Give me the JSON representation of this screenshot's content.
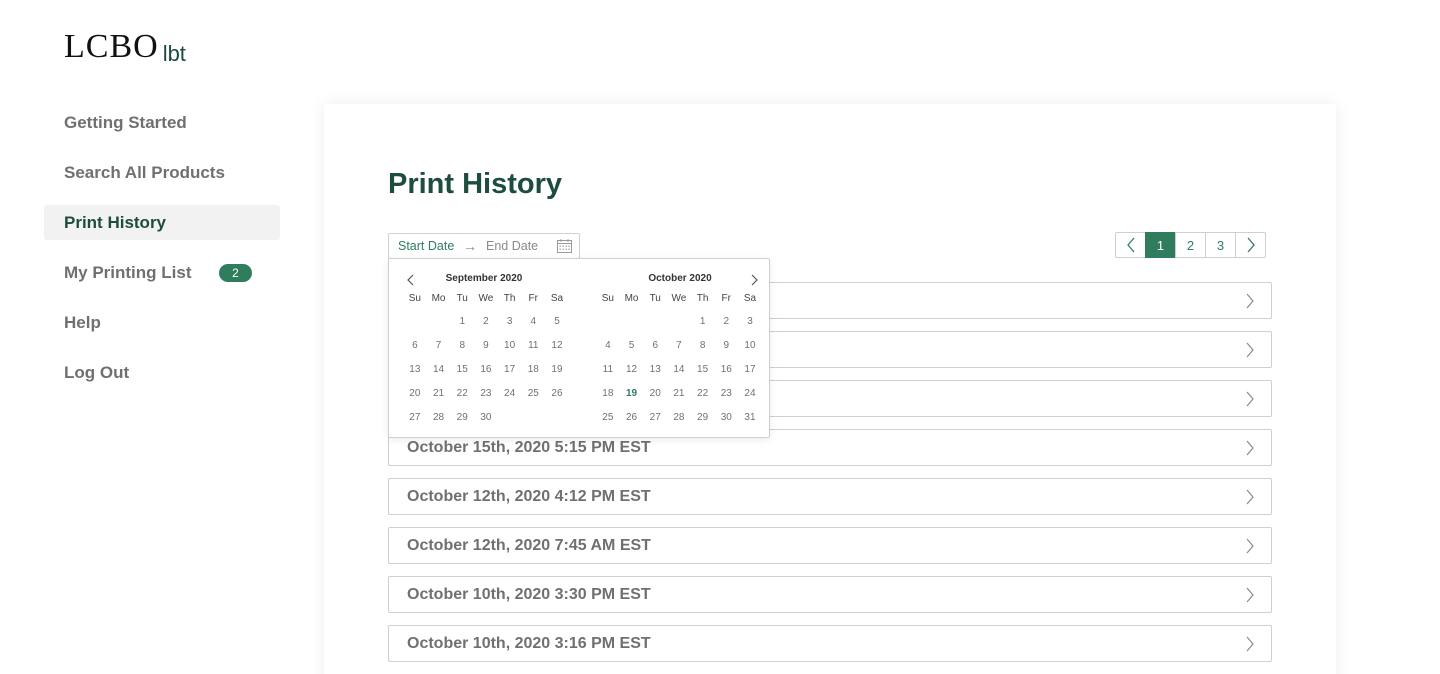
{
  "logo": {
    "main": "LCBO",
    "sub": "lbt"
  },
  "sidebar": {
    "items": [
      {
        "label": "Getting Started"
      },
      {
        "label": "Search All Products"
      },
      {
        "label": "Print History"
      },
      {
        "label": "My Printing List",
        "badge": "2"
      },
      {
        "label": "Help"
      },
      {
        "label": "Log Out"
      }
    ]
  },
  "main": {
    "title": "Print History",
    "date_range": {
      "start_placeholder": "Start Date",
      "arrow": "→",
      "end_placeholder": "End Date"
    },
    "pagination": {
      "pages": [
        "1",
        "2",
        "3"
      ],
      "current": "1"
    },
    "history": [
      "",
      "",
      "",
      "October 15th, 2020 5:15 PM EST",
      "October 12th, 2020 4:12 PM EST",
      "October 12th, 2020 7:45 AM EST",
      "October 10th, 2020 3:30 PM EST",
      "October 10th, 2020 3:16 PM EST"
    ]
  },
  "calendar": {
    "weekdays": [
      "Su",
      "Mo",
      "Tu",
      "We",
      "Th",
      "Fr",
      "Sa"
    ],
    "months": [
      {
        "title": "September 2020",
        "weeks": [
          [
            "",
            "",
            "1",
            "2",
            "3",
            "4",
            "5"
          ],
          [
            "6",
            "7",
            "8",
            "9",
            "10",
            "11",
            "12"
          ],
          [
            "13",
            "14",
            "15",
            "16",
            "17",
            "18",
            "19"
          ],
          [
            "20",
            "21",
            "22",
            "23",
            "24",
            "25",
            "26"
          ],
          [
            "27",
            "28",
            "29",
            "30",
            "",
            "",
            ""
          ]
        ]
      },
      {
        "title": "October 2020",
        "weeks": [
          [
            "",
            "",
            "",
            "",
            "1",
            "2",
            "3"
          ],
          [
            "4",
            "5",
            "6",
            "7",
            "8",
            "9",
            "10"
          ],
          [
            "11",
            "12",
            "13",
            "14",
            "15",
            "16",
            "17"
          ],
          [
            "18",
            "19",
            "20",
            "21",
            "22",
            "23",
            "24"
          ],
          [
            "25",
            "26",
            "27",
            "28",
            "29",
            "30",
            "31"
          ]
        ],
        "today": "19"
      }
    ]
  },
  "colors": {
    "brand_green": "#1e4d3d",
    "accent_green": "#2f7d5d",
    "muted_text": "#707070"
  }
}
